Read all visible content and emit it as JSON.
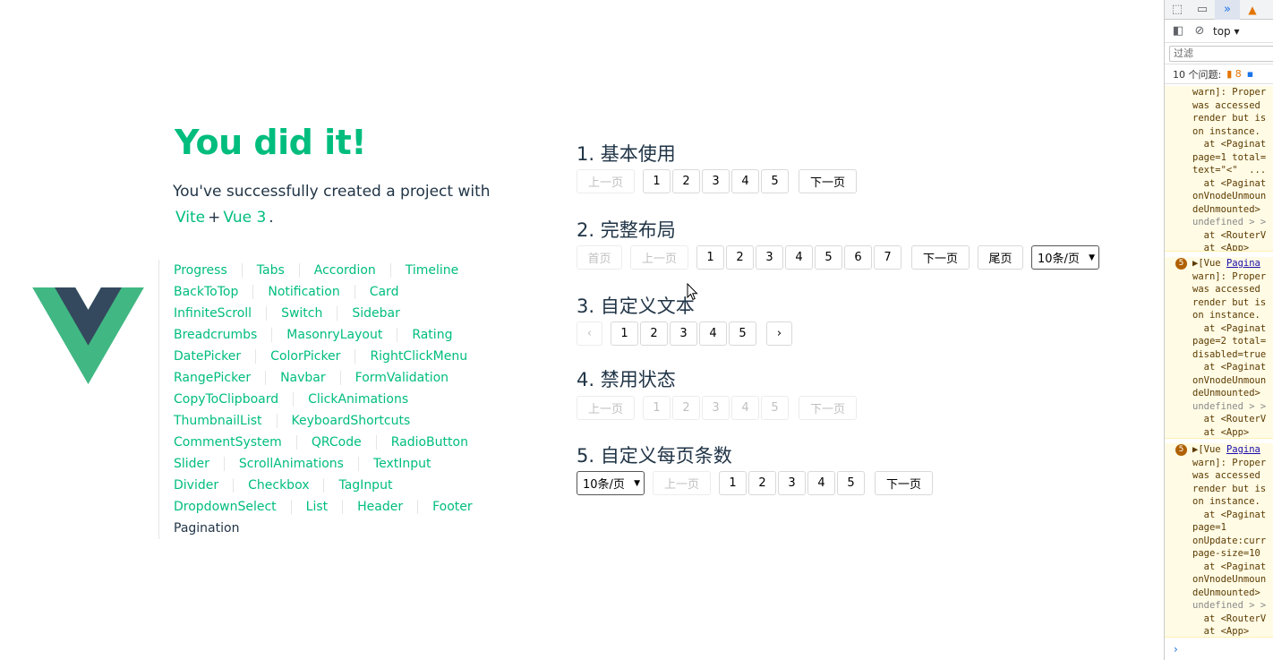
{
  "welcome": {
    "title": "You did it!",
    "subtitle_prefix": "You've successfully created a project with",
    "vite_link": "Vite",
    "plus": "+",
    "vue_link": "Vue 3",
    "period": "."
  },
  "nav": {
    "items": [
      "Progress",
      "Tabs",
      "Accordion",
      "Timeline",
      "BackToTop",
      "Notification",
      "Card",
      "InfiniteScroll",
      "Switch",
      "Sidebar",
      "Breadcrumbs",
      "MasonryLayout",
      "Rating",
      "DatePicker",
      "ColorPicker",
      "RightClickMenu",
      "RangePicker",
      "Navbar",
      "FormValidation",
      "CopyToClipboard",
      "ClickAnimations",
      "ThumbnailList",
      "KeyboardShortcuts",
      "CommentSystem",
      "QRCode",
      "RadioButton",
      "Slider",
      "ScrollAnimations",
      "TextInput",
      "Divider",
      "Checkbox",
      "TagInput",
      "DropdownSelect",
      "List",
      "Header",
      "Footer",
      "Pagination"
    ],
    "active": "Pagination"
  },
  "demos": {
    "d1": {
      "title": "1. 基本使用",
      "prev": "上一页",
      "pages": [
        "1",
        "2",
        "3",
        "4",
        "5"
      ],
      "next": "下一页"
    },
    "d2": {
      "title": "2. 完整布局",
      "first": "首页",
      "prev": "上一页",
      "pages": [
        "1",
        "2",
        "3",
        "4",
        "5",
        "6",
        "7"
      ],
      "next": "下一页",
      "last": "尾页",
      "size": "10条/页"
    },
    "d3": {
      "title": "3. 自定义文本",
      "prev": "‹",
      "pages": [
        "1",
        "2",
        "3",
        "4",
        "5"
      ],
      "next": "›"
    },
    "d4": {
      "title": "4. 禁用状态",
      "prev": "上一页",
      "pages": [
        "1",
        "2",
        "3",
        "4",
        "5"
      ],
      "next": "下一页"
    },
    "d5": {
      "title": "5. 自定义每页条数",
      "size": "10条/页",
      "prev": "上一页",
      "pages": [
        "1",
        "2",
        "3",
        "4",
        "5"
      ],
      "next": "下一页"
    }
  },
  "devtools": {
    "context": "top",
    "filter_placeholder": "过滤",
    "issues_label": "10 个问题:",
    "issues_warn_count": "8",
    "messages": [
      {
        "lines": [
          "warn]: Proper",
          "was accessed ",
          "render but is",
          "on instance. ",
          "  at <Paginat",
          "page=1 total=",
          "text=\"<\"  ...",
          "  at <Paginat",
          "onVnodeUnmoun",
          "deUnmounted> ",
          "undefined > >",
          "  at <RouterV",
          "  at <App>"
        ]
      },
      {
        "count": "5",
        "head": "▶[Vue ",
        "head_link": "Pagina",
        "lines": [
          "warn]: Proper",
          "was accessed ",
          "render but is",
          "on instance. ",
          "  at <Paginat",
          "page=2 total=",
          "disabled=true",
          "  at <Paginat",
          "onVnodeUnmoun",
          "deUnmounted> ",
          "undefined > >",
          "  at <RouterV",
          "  at <App>"
        ]
      },
      {
        "count": "5",
        "head": "▶[Vue ",
        "head_link": "Pagina",
        "lines": [
          "warn]: Proper",
          "was accessed ",
          "render but is",
          "on instance. ",
          "  at <Paginat",
          "page=1 ",
          "onUpdate:curr",
          "page-size=10 ",
          "  at <Paginat",
          "onVnodeUnmoun",
          "deUnmounted> ",
          "undefined > >",
          "  at <RouterV",
          "  at <App>"
        ]
      }
    ]
  }
}
